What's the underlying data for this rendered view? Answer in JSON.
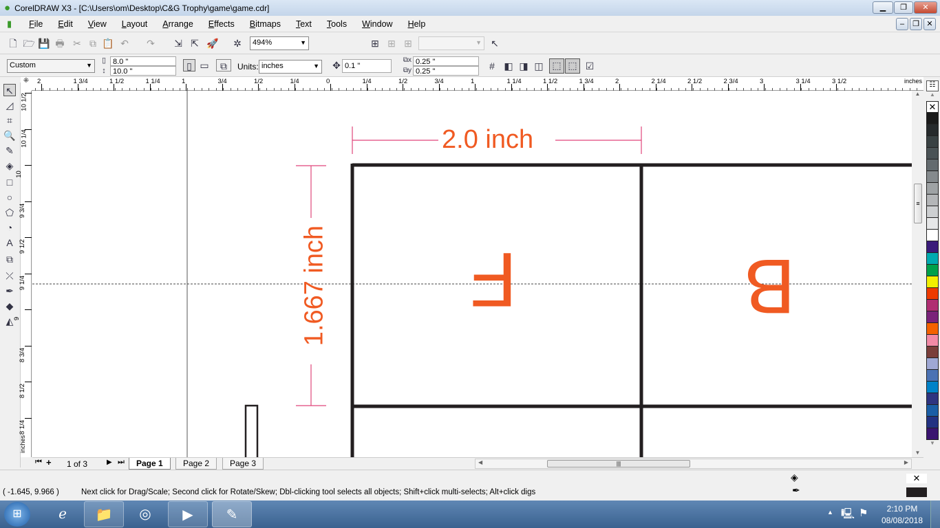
{
  "window": {
    "title": "CorelDRAW X3 - [C:\\Users\\om\\Desktop\\C&G Trophy\\game\\game.cdr]",
    "min": "▁",
    "restore": "❐",
    "close": "✕",
    "doc_min": "–",
    "doc_restore": "❐",
    "doc_close": "✕"
  },
  "menu": [
    "File",
    "Edit",
    "View",
    "Layout",
    "Arrange",
    "Effects",
    "Bitmaps",
    "Text",
    "Tools",
    "Window",
    "Help"
  ],
  "standard_toolbar": {
    "zoom": "494%",
    "icons": [
      "new-icon",
      "open-icon",
      "save-icon",
      "print-icon",
      "cut-icon",
      "copy-icon",
      "paste-icon",
      "undo-icon",
      "redo-icon",
      "import-icon",
      "export-icon",
      "application-launcher-icon",
      "welcome-screen-icon"
    ]
  },
  "property_bar": {
    "paper_preset": "Custom",
    "width": "8.0 \"",
    "height": "10.0 \"",
    "units_label": "Units:",
    "units": "inches",
    "nudge": "0.1 \"",
    "dup_x": "0.25 \"",
    "dup_y": "0.25 \""
  },
  "rulers": {
    "horizontal": [
      "2",
      "1 3/4",
      "1 1/2",
      "1 1/4",
      "1",
      "3/4",
      "1/2",
      "1/4",
      "0",
      "1/4",
      "1/2",
      "3/4",
      "1",
      "1 1/4",
      "1 1/2",
      "1 3/4",
      "2",
      "2 1/4",
      "2 1/2",
      "2 3/4",
      "3",
      "3 1/4",
      "3 1/2"
    ],
    "unit": "inches",
    "vertical": [
      "10 1/2",
      "10 1/4",
      "10",
      "9 3/4",
      "9 1/2",
      "9 1/4",
      "9",
      "8 3/4",
      "8 1/2",
      "8 1/4"
    ]
  },
  "canvas": {
    "width_dim": "2.0 inch",
    "height_dim": "1.667 inch",
    "letter1": "F",
    "letter2": "B",
    "text_color": "#f05a22",
    "dim_color": "#e0457a",
    "line_color": "#231f20"
  },
  "palette": [
    "#1a1a1a",
    "#262a2c",
    "#394143",
    "#4a5255",
    "#646b6f",
    "#858a8d",
    "#9fa3a5",
    "#b4b6b8",
    "#cdcfd1",
    "#e6e7e8",
    "#ffffff",
    "#3a1b7a",
    "#00aab0",
    "#00a04a",
    "#f2ef00",
    "#ee3a00",
    "#b02e72",
    "#7a237a",
    "#f46200",
    "#f28aa6",
    "#7a3e3a",
    "#9fa8d4",
    "#4b72b4",
    "#0082c8",
    "#2e3480",
    "#1a5ea6",
    "#233282",
    "#3a1470"
  ],
  "pages": {
    "counter": "1 of 3",
    "tabs": [
      "Page 1",
      "Page 2",
      "Page 3"
    ],
    "active": 0
  },
  "status": {
    "coords": "( -1.645, 9.966 )",
    "hint": "Next click for Drag/Scale; Second click for Rotate/Skew; Dbl-clicking tool selects all objects; Shift+click multi-selects; Alt+click digs"
  },
  "taskbar": {
    "time": "2:10 PM",
    "date": "08/08/2018"
  }
}
